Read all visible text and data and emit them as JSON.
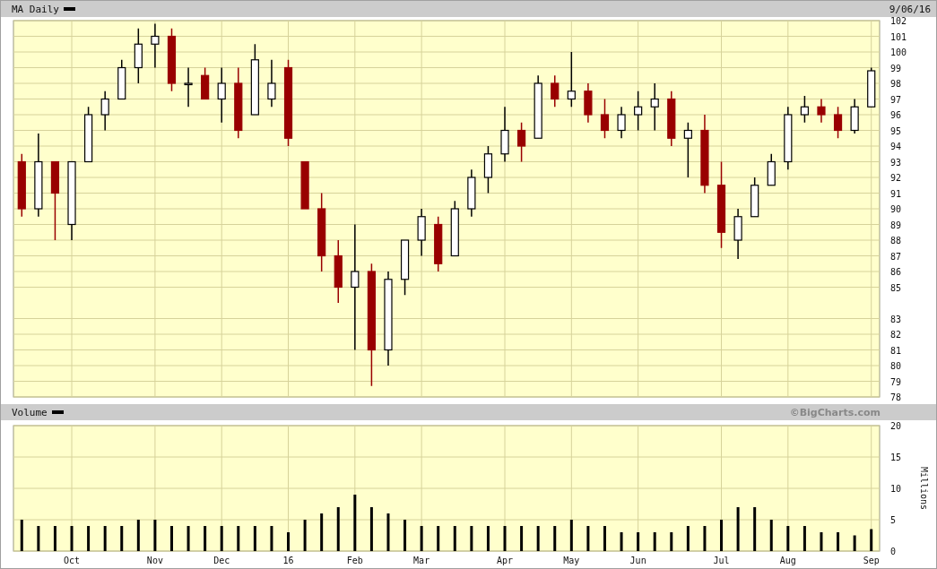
{
  "price_panel": {
    "title": "MA Daily",
    "date": "9/06/16",
    "chart_data": {
      "type": "candlestick",
      "grid": true,
      "ylim": [
        78,
        102
      ],
      "yticks": [
        78,
        79,
        80,
        81,
        82,
        83,
        85,
        86,
        87,
        88,
        89,
        90,
        91,
        92,
        93,
        94,
        95,
        96,
        97,
        98,
        99,
        100,
        101,
        102
      ],
      "categories": [
        null,
        null,
        null,
        null,
        null,
        null,
        null,
        null,
        null,
        null,
        null,
        null,
        null,
        null,
        null,
        null,
        null,
        null,
        null,
        null,
        null,
        null,
        null,
        null,
        null,
        null,
        null,
        null,
        null,
        null,
        null,
        null,
        null,
        null,
        null,
        null,
        null,
        null,
        null,
        null,
        null,
        null,
        null,
        null,
        null,
        null,
        null,
        null,
        null,
        null,
        null,
        null
      ],
      "ohlc": [
        [
          93,
          93.5,
          89.5,
          90
        ],
        [
          90,
          94.8,
          89.5,
          93
        ],
        [
          93,
          93,
          88,
          91
        ],
        [
          89,
          93,
          88,
          93
        ],
        [
          93,
          96.5,
          93,
          96
        ],
        [
          96,
          97.5,
          95,
          97
        ],
        [
          97,
          99.5,
          97,
          99
        ],
        [
          99,
          101.5,
          98,
          100.5
        ],
        [
          100.5,
          101.8,
          99,
          101
        ],
        [
          101,
          101.5,
          97.5,
          98
        ],
        [
          98,
          99,
          96.5,
          98
        ],
        [
          98.5,
          99,
          97,
          97
        ],
        [
          97,
          99,
          95.5,
          98
        ],
        [
          98,
          99,
          94.5,
          95
        ],
        [
          96,
          100.5,
          96,
          99.5
        ],
        [
          97,
          99.5,
          96.5,
          98
        ],
        [
          99,
          99.5,
          94,
          94.5
        ],
        [
          93,
          93,
          90,
          90
        ],
        [
          90,
          91,
          86,
          87
        ],
        [
          87,
          88,
          84,
          85
        ],
        [
          85,
          89,
          81,
          86
        ],
        [
          86,
          86.5,
          78.7,
          81
        ],
        [
          81,
          86,
          80,
          85.5
        ],
        [
          85.5,
          88,
          84.5,
          88
        ],
        [
          88,
          90,
          87,
          89.5
        ],
        [
          89,
          89.5,
          86,
          86.5
        ],
        [
          87,
          90.5,
          87,
          90
        ],
        [
          90,
          92.5,
          89.5,
          92
        ],
        [
          92,
          94,
          91,
          93.5
        ],
        [
          93.5,
          96.5,
          93,
          95
        ],
        [
          95,
          95.5,
          93,
          94
        ],
        [
          94.5,
          98.5,
          94.5,
          98
        ],
        [
          98,
          98.5,
          96.5,
          97
        ],
        [
          97,
          100,
          96.5,
          97.5
        ],
        [
          97.5,
          98,
          95.5,
          96
        ],
        [
          96,
          97,
          94.5,
          95
        ],
        [
          95,
          96.5,
          94.5,
          96
        ],
        [
          96,
          97.5,
          95,
          96.5
        ],
        [
          96.5,
          98,
          95,
          97
        ],
        [
          97,
          97.5,
          94,
          94.5
        ],
        [
          94.5,
          95.5,
          92,
          95
        ],
        [
          95,
          96,
          91,
          91.5
        ],
        [
          91.5,
          93,
          87.5,
          88.5
        ],
        [
          88,
          90,
          86.8,
          89.5
        ],
        [
          89.5,
          92,
          89.5,
          91.5
        ],
        [
          91.5,
          93.5,
          91.5,
          93
        ],
        [
          93,
          96.5,
          92.5,
          96
        ],
        [
          96,
          97.2,
          95.5,
          96.5
        ],
        [
          96.5,
          97,
          95.5,
          96
        ],
        [
          96,
          96.5,
          94.5,
          95
        ],
        [
          95,
          97,
          94.8,
          96.5
        ],
        [
          96.5,
          99,
          96.5,
          98.8
        ]
      ]
    }
  },
  "volume_panel": {
    "title": "Volume",
    "credit": "©BigCharts.com",
    "chart_data": {
      "type": "bar",
      "grid": true,
      "ylabel": "Millions",
      "ylim": [
        0,
        20
      ],
      "yticks": [
        0,
        5,
        10,
        15,
        20
      ],
      "categories": [
        null,
        null,
        null,
        "Oct",
        null,
        null,
        null,
        null,
        "Nov",
        null,
        null,
        null,
        "Dec",
        null,
        null,
        null,
        "16",
        null,
        null,
        null,
        "Feb",
        null,
        null,
        null,
        "Mar",
        null,
        null,
        null,
        null,
        "Apr",
        null,
        null,
        null,
        "May",
        null,
        null,
        null,
        "Jun",
        null,
        null,
        null,
        null,
        "Jul",
        null,
        null,
        null,
        "Aug",
        null,
        null,
        null,
        null,
        "Sep"
      ],
      "values": [
        5,
        4,
        4,
        4,
        4,
        4,
        4,
        5,
        5,
        4,
        4,
        4,
        4,
        4,
        4,
        4,
        3,
        5,
        6,
        7,
        9,
        7,
        6,
        5,
        4,
        4,
        4,
        4,
        4,
        4,
        4,
        4,
        4,
        5,
        4,
        4,
        3,
        3,
        3,
        3,
        4,
        4,
        5,
        7,
        7,
        5,
        4,
        4,
        3,
        3,
        2.5,
        3.5
      ]
    }
  }
}
